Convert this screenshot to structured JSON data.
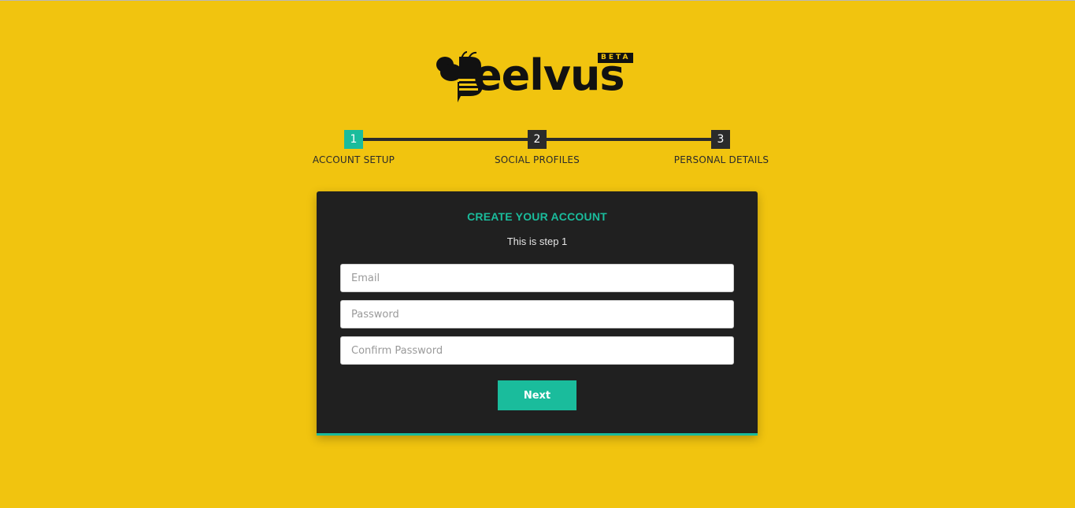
{
  "brand": {
    "name": "Beelvus",
    "word": "eelvus",
    "badge": "BETA"
  },
  "steps": [
    {
      "number": "1",
      "label": "ACCOUNT SETUP",
      "active": true
    },
    {
      "number": "2",
      "label": "SOCIAL PROFILES",
      "active": false
    },
    {
      "number": "3",
      "label": "PERSONAL DETAILS",
      "active": false
    }
  ],
  "form": {
    "title": "CREATE YOUR ACCOUNT",
    "subtitle": "This is step 1",
    "email": {
      "placeholder": "Email",
      "value": ""
    },
    "password": {
      "placeholder": "Password",
      "value": ""
    },
    "confirm_password": {
      "placeholder": "Confirm Password",
      "value": ""
    },
    "next_label": "Next"
  },
  "colors": {
    "background": "#f1c40f",
    "accent": "#1abc9c",
    "card": "#202020",
    "step_inactive": "#2b2b2b"
  }
}
